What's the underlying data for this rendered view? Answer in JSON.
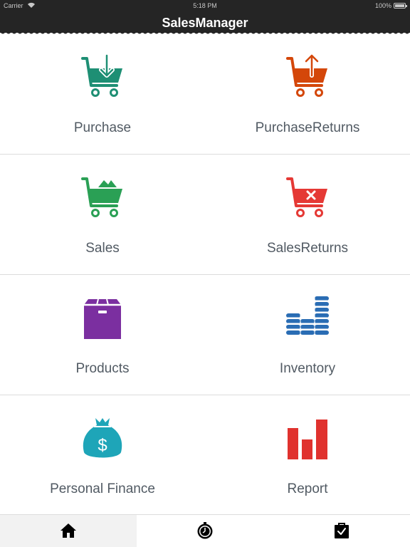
{
  "status_bar": {
    "carrier": "Carrier",
    "time": "5:18 PM",
    "battery": "100%"
  },
  "nav": {
    "title": "SalesManager"
  },
  "tiles": [
    {
      "label": "Purchase",
      "icon": "cart-download-icon",
      "color": "#1e8f74"
    },
    {
      "label": "PurchaseReturns",
      "icon": "cart-upload-icon",
      "color": "#d4470a"
    },
    {
      "label": "Sales",
      "icon": "cart-full-icon",
      "color": "#2aa055"
    },
    {
      "label": "SalesReturns",
      "icon": "cart-cancel-icon",
      "color": "#e53935"
    },
    {
      "label": "Products",
      "icon": "box-icon",
      "color": "#7b2fa0"
    },
    {
      "label": "Inventory",
      "icon": "coins-stack-icon",
      "color": "#2a6db4"
    },
    {
      "label": "Personal Finance",
      "icon": "money-bag-icon",
      "color": "#1ea5b8"
    },
    {
      "label": "Report",
      "icon": "bar-chart-icon",
      "color": "#e0322e"
    }
  ],
  "tab_bar": {
    "tabs": [
      {
        "icon": "home-icon",
        "selected": true
      },
      {
        "icon": "stopwatch-icon",
        "selected": false
      },
      {
        "icon": "checklist-bag-icon",
        "selected": false
      }
    ]
  }
}
